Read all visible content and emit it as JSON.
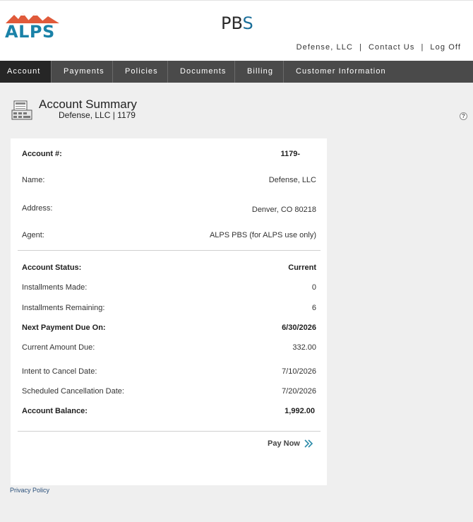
{
  "header": {
    "alps_logo_text": "ALPS",
    "pbs_logo": {
      "p": "P",
      "b": "B",
      "s": "S"
    },
    "links": {
      "company": "Defense, LLC",
      "separator": "|",
      "contact": "Contact Us",
      "logoff": "Log Off"
    }
  },
  "nav": {
    "tabs": [
      {
        "label": "Account",
        "active": true
      },
      {
        "label": "Payments"
      },
      {
        "label": "Policies"
      },
      {
        "label": "Documents"
      },
      {
        "label": "Billing"
      },
      {
        "label": "Customer Information"
      }
    ]
  },
  "summary": {
    "title": "Account Summary",
    "subtitle": "Defense, LLC | 1179",
    "help_glyph": "?"
  },
  "account": {
    "number_label": "Account #:",
    "number_value": "1179-",
    "name_label": "Name:",
    "name_value": "Defense, LLC",
    "address_label": "Address:",
    "address_value": "Denver, CO 80218",
    "agent_label": "Agent:",
    "agent_value": "ALPS PBS (for ALPS use only)",
    "status_label": "Account Status:",
    "status_value": "Current",
    "installments_made_label": "Installments Made:",
    "installments_made_value": "0",
    "installments_remaining_label": "Installments Remaining:",
    "installments_remaining_value": "6",
    "next_payment_label": "Next Payment Due On:",
    "next_payment_value": "6/30/2026",
    "current_due_label": "Current Amount Due:",
    "current_due_value": "332.00",
    "intent_cancel_label": "Intent to Cancel Date:",
    "intent_cancel_value": "7/10/2026",
    "sched_cancel_label": "Scheduled Cancellation Date:",
    "sched_cancel_value": "7/20/2026",
    "balance_label": "Account Balance:",
    "balance_value": "1,992.00"
  },
  "pay_now_label": "Pay Now",
  "footer": {
    "privacy": "Privacy Policy"
  },
  "colors": {
    "nav_bg": "#4a4a4a",
    "nav_active": "#262626",
    "alps_blue": "#1a82a8",
    "alps_mountain": "#e05a3a",
    "page_bg": "#efefef"
  }
}
